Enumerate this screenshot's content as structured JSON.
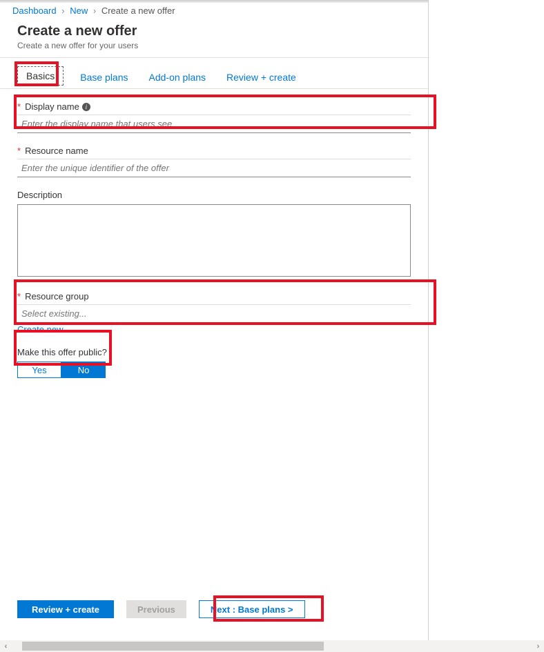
{
  "breadcrumb": {
    "items": [
      "Dashboard",
      "New",
      "Create a new offer"
    ]
  },
  "header": {
    "title": "Create a new offer",
    "subtitle": "Create a new offer for your users"
  },
  "tabs": [
    {
      "label": "Basics",
      "active": true
    },
    {
      "label": "Base plans",
      "active": false
    },
    {
      "label": "Add-on plans",
      "active": false
    },
    {
      "label": "Review + create",
      "active": false
    }
  ],
  "fields": {
    "display_name": {
      "label": "Display name",
      "required": true,
      "info": true,
      "placeholder": "Enter the display name that users see"
    },
    "resource_name": {
      "label": "Resource name",
      "required": true,
      "placeholder": "Enter the unique identifier of the offer"
    },
    "description": {
      "label": "Description"
    },
    "resource_group": {
      "label": "Resource group",
      "required": true,
      "placeholder": "Select existing...",
      "create_link": "Create new"
    },
    "public": {
      "label": "Make this offer public?",
      "yes": "Yes",
      "no": "No",
      "value": "No"
    }
  },
  "footer": {
    "review": "Review + create",
    "previous": "Previous",
    "next": "Next : Base plans >"
  }
}
